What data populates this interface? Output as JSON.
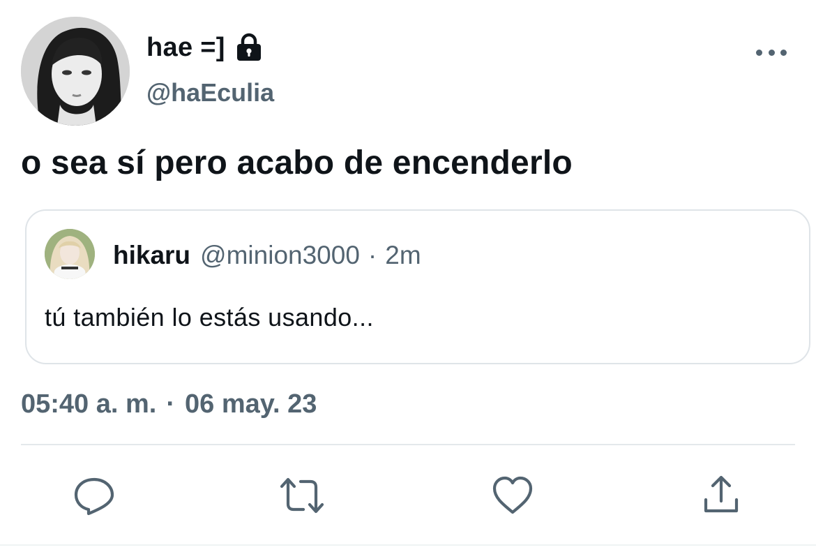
{
  "author": {
    "display_name": "hae =]",
    "handle": "@haEculia",
    "protected_icon": "lock-icon"
  },
  "tweet": {
    "text": "o sea sí pero acabo de encenderlo",
    "time": "05:40 a. m.",
    "separator": "·",
    "date": "06 may. 23"
  },
  "quoted_tweet": {
    "display_name": "hikaru",
    "handle": "@minion3000",
    "separator": "·",
    "relative_time": "2m",
    "text": "tú también lo estás usando..."
  },
  "actions": {
    "reply_icon": "reply-icon",
    "retweet_icon": "retweet-icon",
    "like_icon": "like-icon",
    "share_icon": "share-icon"
  },
  "colors": {
    "text_primary": "#0f1419",
    "text_secondary": "#536471",
    "border": "#dfe4e8"
  }
}
